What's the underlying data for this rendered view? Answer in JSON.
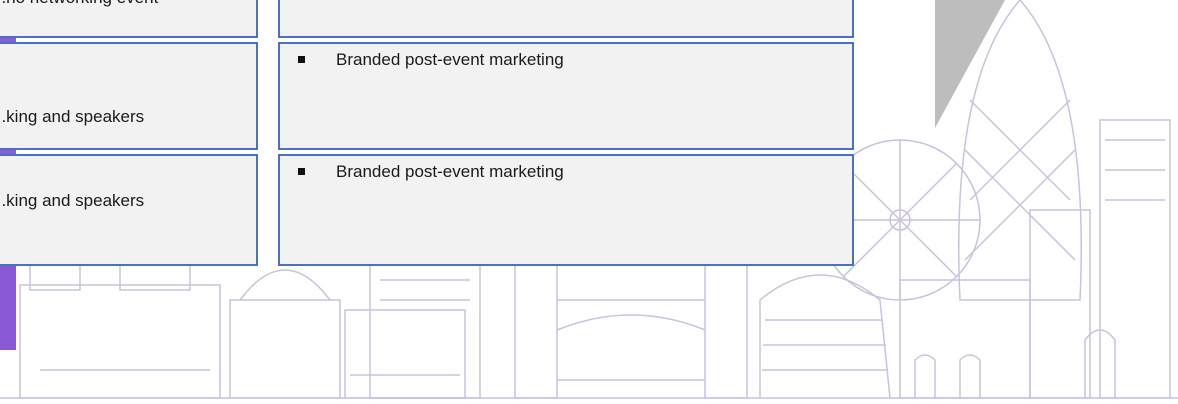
{
  "table": {
    "left_column": [
      {
        "text": "...rio networking event"
      },
      {
        "text": "...king and speakers"
      },
      {
        "text": "...king and speakers"
      }
    ],
    "right_column": [
      {
        "text": ""
      },
      {
        "text": "Branded post-event marketing"
      },
      {
        "text": "Branded post-event marketing"
      }
    ]
  },
  "colors": {
    "cell_background": "#f2f2f2",
    "cell_border": "#4a72c4",
    "accent_purple": "#8a5ad6",
    "skyline_stroke": "#c9c2dd",
    "gray_shape": "#bdbdbd"
  },
  "icons": [
    "bullet-square-icon",
    "london-skyline-illustration"
  ]
}
